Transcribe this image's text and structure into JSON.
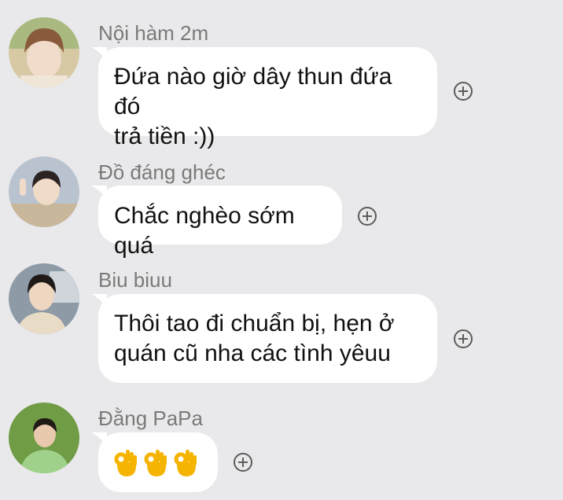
{
  "messages": [
    {
      "sender": "Nội hàm 2m",
      "lines": [
        "Đứa nào giờ dây thun đứa đó",
        "trả tiền :))"
      ]
    },
    {
      "sender": "Đồ đáng ghéc",
      "lines": [
        "Chắc nghèo sớm quá"
      ]
    },
    {
      "sender": "Biu biuu",
      "lines": [
        "Thôi tao đi chuẩn bị, hẹn ở",
        "quán cũ nha các tình yêuu"
      ]
    },
    {
      "sender": "Đằng PaPa",
      "emoji": [
        "👌",
        "👌",
        "👌"
      ]
    }
  ],
  "colors": {
    "background": "#e9e9eb",
    "bubble": "#ffffff",
    "sender_text": "#7a7a7a",
    "message_text": "#111111"
  },
  "icons": {
    "reaction": "add-reaction-icon",
    "emoji": "ok-hand-emoji"
  }
}
